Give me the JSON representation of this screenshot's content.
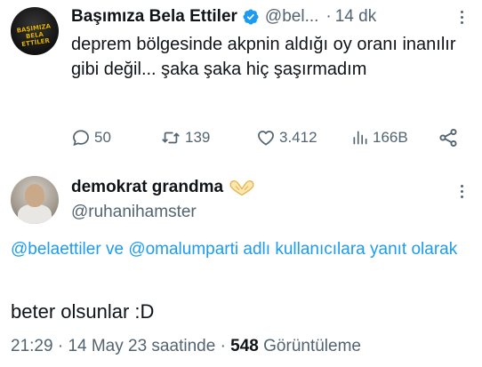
{
  "quoted_tweet": {
    "avatar_text": "BAŞIMIZA BELA ETTİLER",
    "display_name": "Başımıza Bela Ettiler",
    "handle": "@bel...",
    "separator": "·",
    "time": "14 dk",
    "text": "deprem bölgesinde akpnin aldığı oy oranı inanılır gibi değil... şaka şaka hiç şaşırmadım",
    "stats": {
      "replies": "50",
      "retweets": "139",
      "likes": "3.412",
      "views": "166B"
    },
    "icons": [
      "verified-badge-icon",
      "more-icon",
      "reply-icon",
      "retweet-icon",
      "like-icon",
      "views-icon",
      "share-icon"
    ],
    "colors": {
      "verified": "#1d9bf0",
      "muted": "#536471"
    }
  },
  "main_tweet": {
    "display_name": "demokrat grandma",
    "name_emoji": "heart-hands-icon",
    "handle": "@ruhanihamster",
    "reply_mention_1": "@belaettiler",
    "reply_connector": "ve",
    "reply_mention_2": "@omalumparti",
    "reply_suffix": "adlı kullanıcılara yanıt olarak",
    "text": "beter olsunlar :D",
    "time": "21:29",
    "date": "14 May 23 saatinde",
    "views_count": "548",
    "views_label": "Görüntüleme",
    "separator": "·",
    "colors": {
      "mention": "#1d9bf0",
      "text": "#0f1419",
      "muted": "#536471"
    }
  }
}
